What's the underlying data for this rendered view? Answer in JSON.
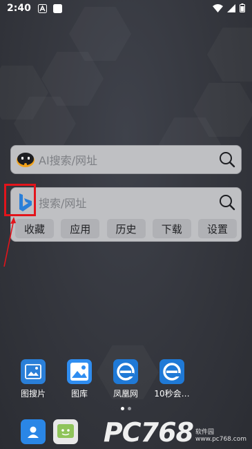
{
  "status_bar": {
    "time": "2:40"
  },
  "search_ai": {
    "placeholder": "AI搜索/网址"
  },
  "search_bing": {
    "placeholder": "搜索/网址"
  },
  "quick_links": [
    {
      "label": "收藏"
    },
    {
      "label": "应用"
    },
    {
      "label": "历史"
    },
    {
      "label": "下载"
    },
    {
      "label": "设置"
    }
  ],
  "home_apps": [
    {
      "label": "图搜片",
      "icon": "image-search-icon"
    },
    {
      "label": "图库",
      "icon": "gallery-icon"
    },
    {
      "label": "凤凰网",
      "icon": "browser-e-icon"
    },
    {
      "label": "10秒会…",
      "icon": "browser-e-icon"
    }
  ],
  "page_indicator": {
    "pages": 2,
    "current": 1
  },
  "watermark": {
    "brand": "PC768",
    "sub1": "软件园",
    "sub2": "www.pc768.com"
  },
  "colors": {
    "highlight": "#e3141b",
    "widget_bg": "#bfc0c3",
    "app_blue": "#2a7fd8"
  }
}
